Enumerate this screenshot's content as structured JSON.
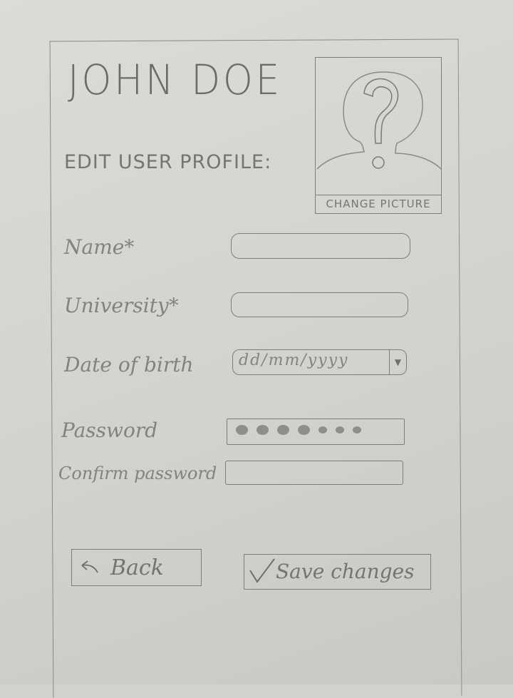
{
  "header": {
    "title": "JOHN DOE",
    "subtitle": "EDIT USER PROFILE:"
  },
  "profile_picture": {
    "icon": "question-mark-icon",
    "change_label": "CHANGE PICTURE"
  },
  "form": {
    "name": {
      "label": "Name*",
      "value": ""
    },
    "university": {
      "label": "University*",
      "value": ""
    },
    "date_of_birth": {
      "label": "Date of birth",
      "placeholder": "dd/mm/yyyy",
      "dropdown_icon": "triangle-down-icon"
    },
    "password": {
      "label": "Password",
      "masked_char_count": 7
    },
    "confirm_password": {
      "label": "Confirm password",
      "value": ""
    }
  },
  "actions": {
    "back": {
      "label": "Back",
      "icon": "back-arrow-icon"
    },
    "save": {
      "label": "Save changes",
      "icon": "checkmark-icon"
    }
  }
}
